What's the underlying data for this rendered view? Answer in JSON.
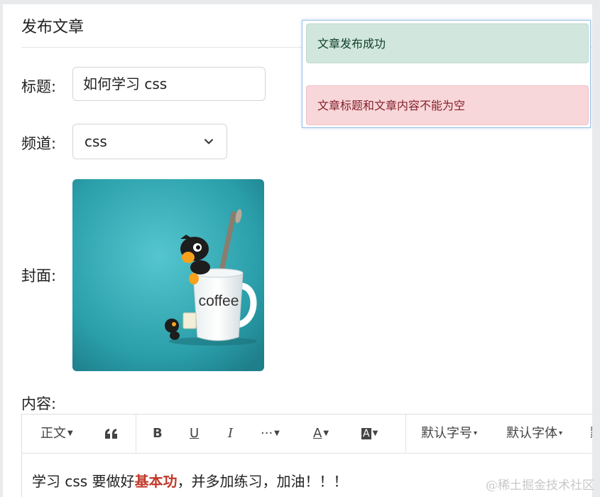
{
  "page": {
    "title": "发布文章"
  },
  "form": {
    "title_label": "标题:",
    "title_value": "如何学习 css",
    "channel_label": "频道:",
    "channel_value": "css",
    "cover_label": "封面:",
    "cover_caption": "coffee",
    "content_label": "内容:"
  },
  "toolbar": {
    "paragraph": "正文",
    "quote_icon": "quote-icon",
    "bold": "B",
    "underline": "U",
    "italic": "I",
    "more": "···",
    "font_color": "A",
    "bg_color": "A",
    "font_size": "默认字号",
    "font_family": "默认字体",
    "cut_label": "默"
  },
  "content": {
    "before": "学习 css 要做好",
    "highlight": "基本功",
    "after": "，并多加练习，加油！！！"
  },
  "toasts": {
    "success": "文章发布成功",
    "error": "文章标题和文章内容不能为空"
  },
  "colors": {
    "success_bg": "#d1e7dd",
    "error_bg": "#f8d7da",
    "highlight": "#c0392b",
    "cover_bg": "#2fa5b0"
  },
  "watermark": "@稀土掘金技术社区"
}
